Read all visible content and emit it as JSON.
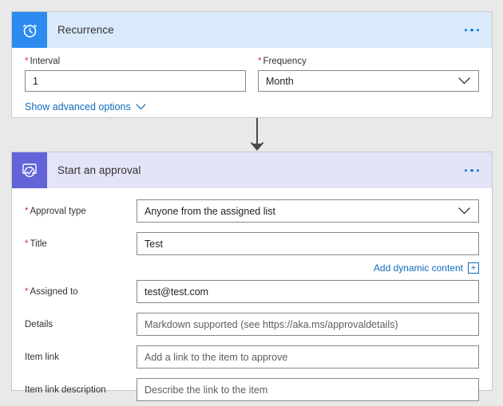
{
  "canvas": {
    "background_color": "#e9e9e9"
  },
  "connector": {
    "name": "flow-connector-arrow",
    "color": "#4a4a4a"
  },
  "recurrence_card": {
    "icon_name": "alarm-clock-icon",
    "icon_bg": "#2d8bf0",
    "header_bg": "#daeafb",
    "title": "Recurrence",
    "menu_label": "More commands",
    "fields": [
      {
        "name": "interval",
        "label": "Interval",
        "required": true,
        "type": "text",
        "value": "1",
        "placeholder": ""
      },
      {
        "name": "frequency",
        "label": "Frequency",
        "required": true,
        "type": "select",
        "value": "Month",
        "placeholder": ""
      }
    ],
    "advanced_link": {
      "label": "Show advanced options",
      "icon_name": "chevron-down-icon",
      "color": "#0f6cbd"
    }
  },
  "approval_card": {
    "icon_name": "approval-check-icon",
    "icon_bg": "#6264d8",
    "header_bg": "#e4e4f8",
    "title": "Start an approval",
    "menu_label": "More commands",
    "fields": [
      {
        "name": "approval-type",
        "label": "Approval type",
        "required": true,
        "type": "select",
        "value": "Anyone from the assigned list",
        "placeholder": ""
      },
      {
        "name": "title",
        "label": "Title",
        "required": true,
        "type": "text",
        "value": "Test",
        "placeholder": ""
      },
      {
        "name": "assigned-to",
        "label": "Assigned to",
        "required": true,
        "type": "text",
        "value": "test@test.com",
        "placeholder": ""
      },
      {
        "name": "details",
        "label": "Details",
        "required": false,
        "type": "text",
        "value": "",
        "placeholder": "Markdown supported (see https://aka.ms/approvaldetails)"
      },
      {
        "name": "item-link",
        "label": "Item link",
        "required": false,
        "type": "text",
        "value": "",
        "placeholder": "Add a link to the item to approve"
      },
      {
        "name": "item-link-description",
        "label": "Item link description",
        "required": false,
        "type": "text",
        "value": "",
        "placeholder": "Describe the link to the item"
      }
    ],
    "dynamic_content": {
      "label": "Add dynamic content",
      "plus_symbol": "+",
      "icon_name": "add-dynamic-content-plus-icon",
      "color": "#0f6cbd"
    }
  },
  "colors": {
    "required_star": "#d13438",
    "link": "#0f6cbd",
    "accent_blue": "#0078d4",
    "accent_purple": "#6264d8",
    "input_border": "#8a8886",
    "card_border": "#c8c8c8"
  },
  "symbols": {
    "star": "*"
  }
}
